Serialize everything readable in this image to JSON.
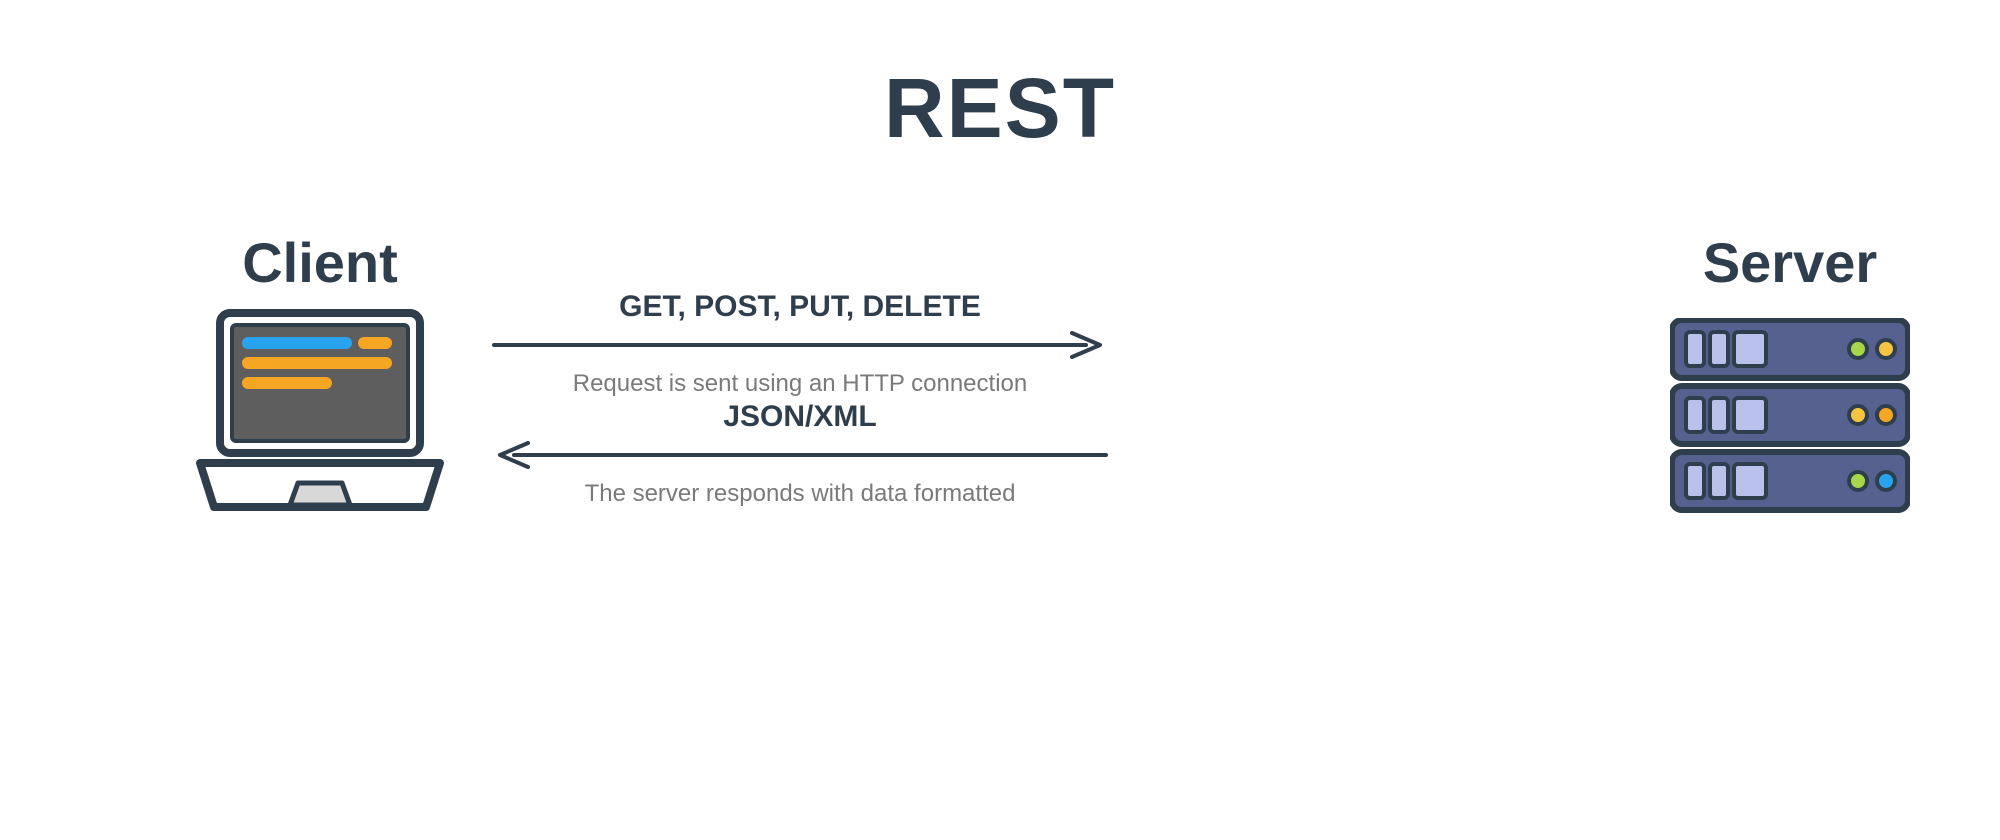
{
  "title": "REST",
  "client": {
    "label": "Client"
  },
  "server": {
    "label": "Server"
  },
  "request": {
    "methods": "GET, POST, PUT, DELETE",
    "caption": "Request is sent using an HTTP connection"
  },
  "response": {
    "format": "JSON/XML",
    "caption": "The server responds with data formatted"
  },
  "colors": {
    "text": "#2f3e4d",
    "muted": "#7a7a7a",
    "outline": "#2f3e4d",
    "screen": "#5e5e5e",
    "bar_blue": "#2aa3ef",
    "bar_orange": "#f5a623",
    "server_body": "#56618f",
    "server_panel": "#b9c0ea",
    "led_green": "#a7d64b",
    "led_yellow": "#f5c542",
    "led_orange": "#f5a623",
    "led_blue": "#2aa3ef"
  },
  "server_leds": [
    [
      "led_green",
      "led_yellow"
    ],
    [
      "led_yellow",
      "led_orange"
    ],
    [
      "led_green",
      "led_blue"
    ]
  ]
}
